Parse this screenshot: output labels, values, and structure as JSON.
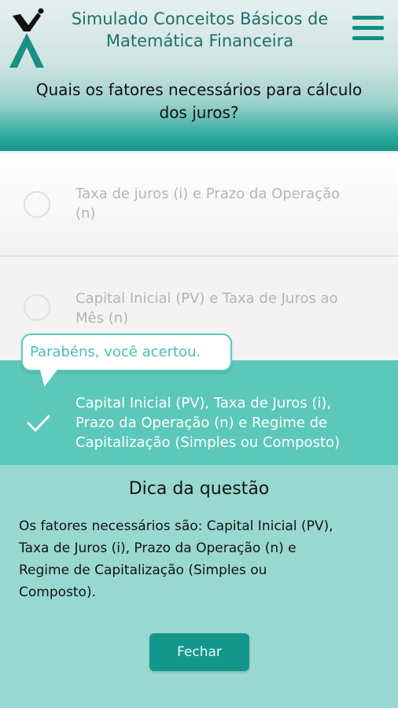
{
  "header": {
    "title_line1": "Simulado Conceitos Básicos de",
    "title_line2": "Matemática Financeira"
  },
  "question": {
    "line1": "Quais os fatores necessários para cálculo",
    "line2": "dos juros?"
  },
  "options": [
    {
      "line1": "Taxa de juros (i) e Prazo da Operação",
      "line2": "(n)",
      "state": "unselected"
    },
    {
      "line1": "Capital Inicial (PV) e Taxa de Juros ao",
      "line2": "Mês (n)",
      "state": "unselected"
    },
    {
      "line1": "Capital Inicial (PV), Taxa de Juros (i),",
      "line2": "Prazo da Operação (n) e Regime de",
      "line3": "Capitalização (Simples ou Composto)",
      "state": "correct"
    }
  ],
  "feedback": {
    "text": "Parabéns, você acertou."
  },
  "hint": {
    "title": "Dica da questão",
    "line1": "Os fatores necessários são: Capital Inicial (PV),",
    "line2": "Taxa de Juros (i), Prazo da Operação (n) e",
    "line3": "Regime de Capitalização (Simples ou",
    "line4": "Composto).",
    "close_label": "Fechar"
  },
  "colors": {
    "accent": "#18958a",
    "correct_bg": "#5cc8b9",
    "hint_bg": "#98d8d0",
    "button": "#13978b"
  },
  "icons": [
    "logo-icon",
    "hamburger-menu-icon",
    "radio-circle-icon",
    "checkmark-icon"
  ]
}
